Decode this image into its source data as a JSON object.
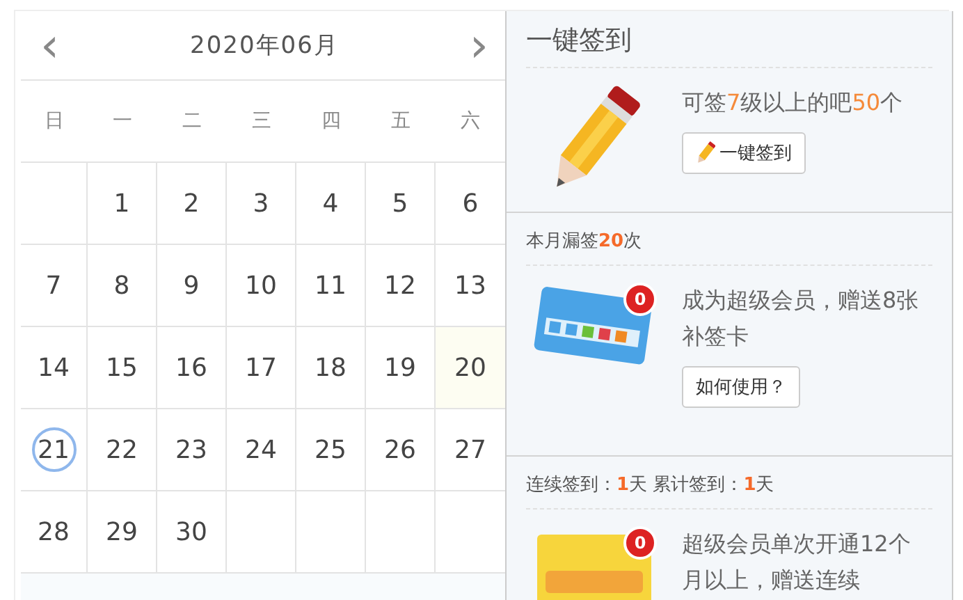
{
  "calendar": {
    "title": "2020年06月",
    "prev": "‹",
    "next": "›",
    "weekdays": [
      "日",
      "一",
      "二",
      "三",
      "四",
      "五",
      "六"
    ],
    "weeks": [
      [
        {
          "signed": false,
          "highlighted": false
        },
        {
          "day": "1",
          "signed": false,
          "highlighted": false
        },
        {
          "day": "2",
          "signed": false,
          "highlighted": false
        },
        {
          "day": "3",
          "signed": false,
          "highlighted": false
        },
        {
          "day": "4",
          "signed": false,
          "highlighted": false
        },
        {
          "day": "5",
          "signed": false,
          "highlighted": false
        },
        {
          "day": "6",
          "signed": false,
          "highlighted": false
        }
      ],
      [
        {
          "day": "7",
          "signed": false,
          "highlighted": false
        },
        {
          "day": "8",
          "signed": false,
          "highlighted": false
        },
        {
          "day": "9",
          "signed": false,
          "highlighted": false
        },
        {
          "day": "10",
          "signed": false,
          "highlighted": false
        },
        {
          "day": "11",
          "signed": false,
          "highlighted": false
        },
        {
          "day": "12",
          "signed": false,
          "highlighted": false
        },
        {
          "day": "13",
          "signed": false,
          "highlighted": false
        }
      ],
      [
        {
          "day": "14",
          "signed": false,
          "highlighted": false
        },
        {
          "day": "15",
          "signed": false,
          "highlighted": false
        },
        {
          "day": "16",
          "signed": false,
          "highlighted": false
        },
        {
          "day": "17",
          "signed": false,
          "highlighted": false
        },
        {
          "day": "18",
          "signed": false,
          "highlighted": false
        },
        {
          "day": "19",
          "signed": false,
          "highlighted": false
        },
        {
          "day": "20",
          "signed": false,
          "highlighted": true
        }
      ],
      [
        {
          "day": "21",
          "signed": true,
          "highlighted": false
        },
        {
          "day": "22",
          "signed": false,
          "highlighted": false
        },
        {
          "day": "23",
          "signed": false,
          "highlighted": false
        },
        {
          "day": "24",
          "signed": false,
          "highlighted": false
        },
        {
          "day": "25",
          "signed": false,
          "highlighted": false
        },
        {
          "day": "26",
          "signed": false,
          "highlighted": false
        },
        {
          "day": "27",
          "signed": false,
          "highlighted": false
        }
      ],
      [
        {
          "day": "28",
          "signed": false,
          "highlighted": false
        },
        {
          "day": "29",
          "signed": false,
          "highlighted": false
        },
        {
          "day": "30",
          "signed": false,
          "highlighted": false
        },
        {
          "signed": false,
          "highlighted": false
        },
        {
          "signed": false,
          "highlighted": false
        },
        {
          "signed": false,
          "highlighted": false
        },
        {
          "signed": false,
          "highlighted": false
        }
      ]
    ]
  },
  "panel": {
    "sections": [
      {
        "kind": "pencil",
        "heading": [
          {
            "text": "一键签到",
            "accent": false,
            "bold": false
          }
        ],
        "description": [
          {
            "text": "可签",
            "accent": false,
            "bold": false
          },
          {
            "text": "7",
            "accent": true,
            "bold": false
          },
          {
            "text": "级以上的吧",
            "accent": false,
            "bold": false
          },
          {
            "text": "50",
            "accent": true,
            "bold": false
          },
          {
            "text": "个",
            "accent": false,
            "bold": false
          }
        ],
        "button": "一键签到"
      },
      {
        "kind": "card",
        "heading": [
          {
            "text": "本月漏签",
            "accent": false,
            "bold": false
          },
          {
            "text": "20",
            "accent": true,
            "bold": true
          },
          {
            "text": "次",
            "accent": false,
            "bold": false
          }
        ],
        "description": [
          {
            "text": "成为超级会员，赠送8张补签卡",
            "accent": false,
            "bold": false
          }
        ],
        "button": "如何使用？",
        "count": "0"
      },
      {
        "kind": "ticket",
        "heading": [
          {
            "text": "连续签到：",
            "accent": false,
            "bold": false
          },
          {
            "text": "1",
            "accent": true,
            "bold": true
          },
          {
            "text": "天  累计签到：",
            "accent": false,
            "bold": false
          },
          {
            "text": "1",
            "accent": true,
            "bold": true
          },
          {
            "text": "天",
            "accent": false,
            "bold": false
          }
        ],
        "description": [
          {
            "text": "超级会员单次开通12个月以上，赠送连续",
            "accent": false,
            "bold": false
          }
        ],
        "count": "0"
      }
    ]
  }
}
